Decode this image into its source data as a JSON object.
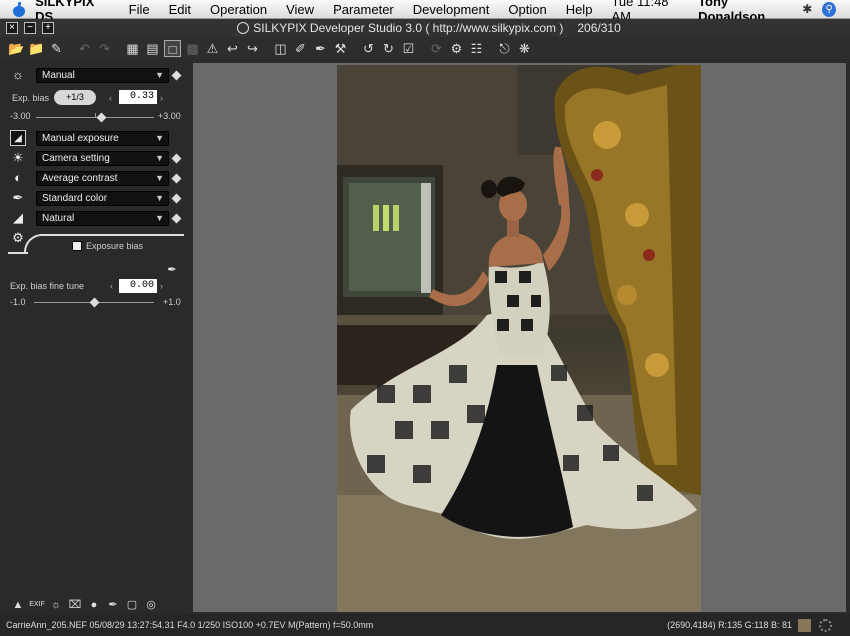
{
  "menubar": {
    "app_name": "SILKYPIX DS",
    "items": [
      "File",
      "Edit",
      "Operation",
      "View",
      "Parameter",
      "Development",
      "Option",
      "Help"
    ],
    "clock": "Tue 11:48 AM",
    "user": "Tony Donaldson"
  },
  "window": {
    "title": "SILKYPIX Developer Studio 3.0 ( http://www.silkypix.com )",
    "counter": "206/310"
  },
  "panel": {
    "preset": "Manual",
    "exp_bias_label": "Exp. bias",
    "exp_bias_step": "+1/3",
    "exp_bias_value": "0.33",
    "exp_bias_min": "-3.00",
    "exp_bias_max": "+3.00",
    "exp_bias_level": 0.555,
    "exposure_mode": "Manual exposure",
    "white_balance": "Camera setting",
    "contrast": "Average contrast",
    "color": "Standard color",
    "sharpness": "Natural",
    "tab_label": "Exposure bias",
    "fine_tune_label": "Exp. bias fine tune",
    "fine_tune_value": "0.00",
    "fine_tune_min": "-1.0",
    "fine_tune_max": "+1.0",
    "fine_tune_level": 0.5
  },
  "status": {
    "info": "CarrieAnn_205.NEF 05/08/29 13:27:54.31 F4.0 1/250 ISO100 +0.7EV M(Pattern) f=50.0mm",
    "coords": "(2690,4184) R:135 G:118 B: 81",
    "swatch_color": "#87765a"
  },
  "colors": {
    "background": "#2b2b2b",
    "preview_bg": "#6a6a6a"
  }
}
